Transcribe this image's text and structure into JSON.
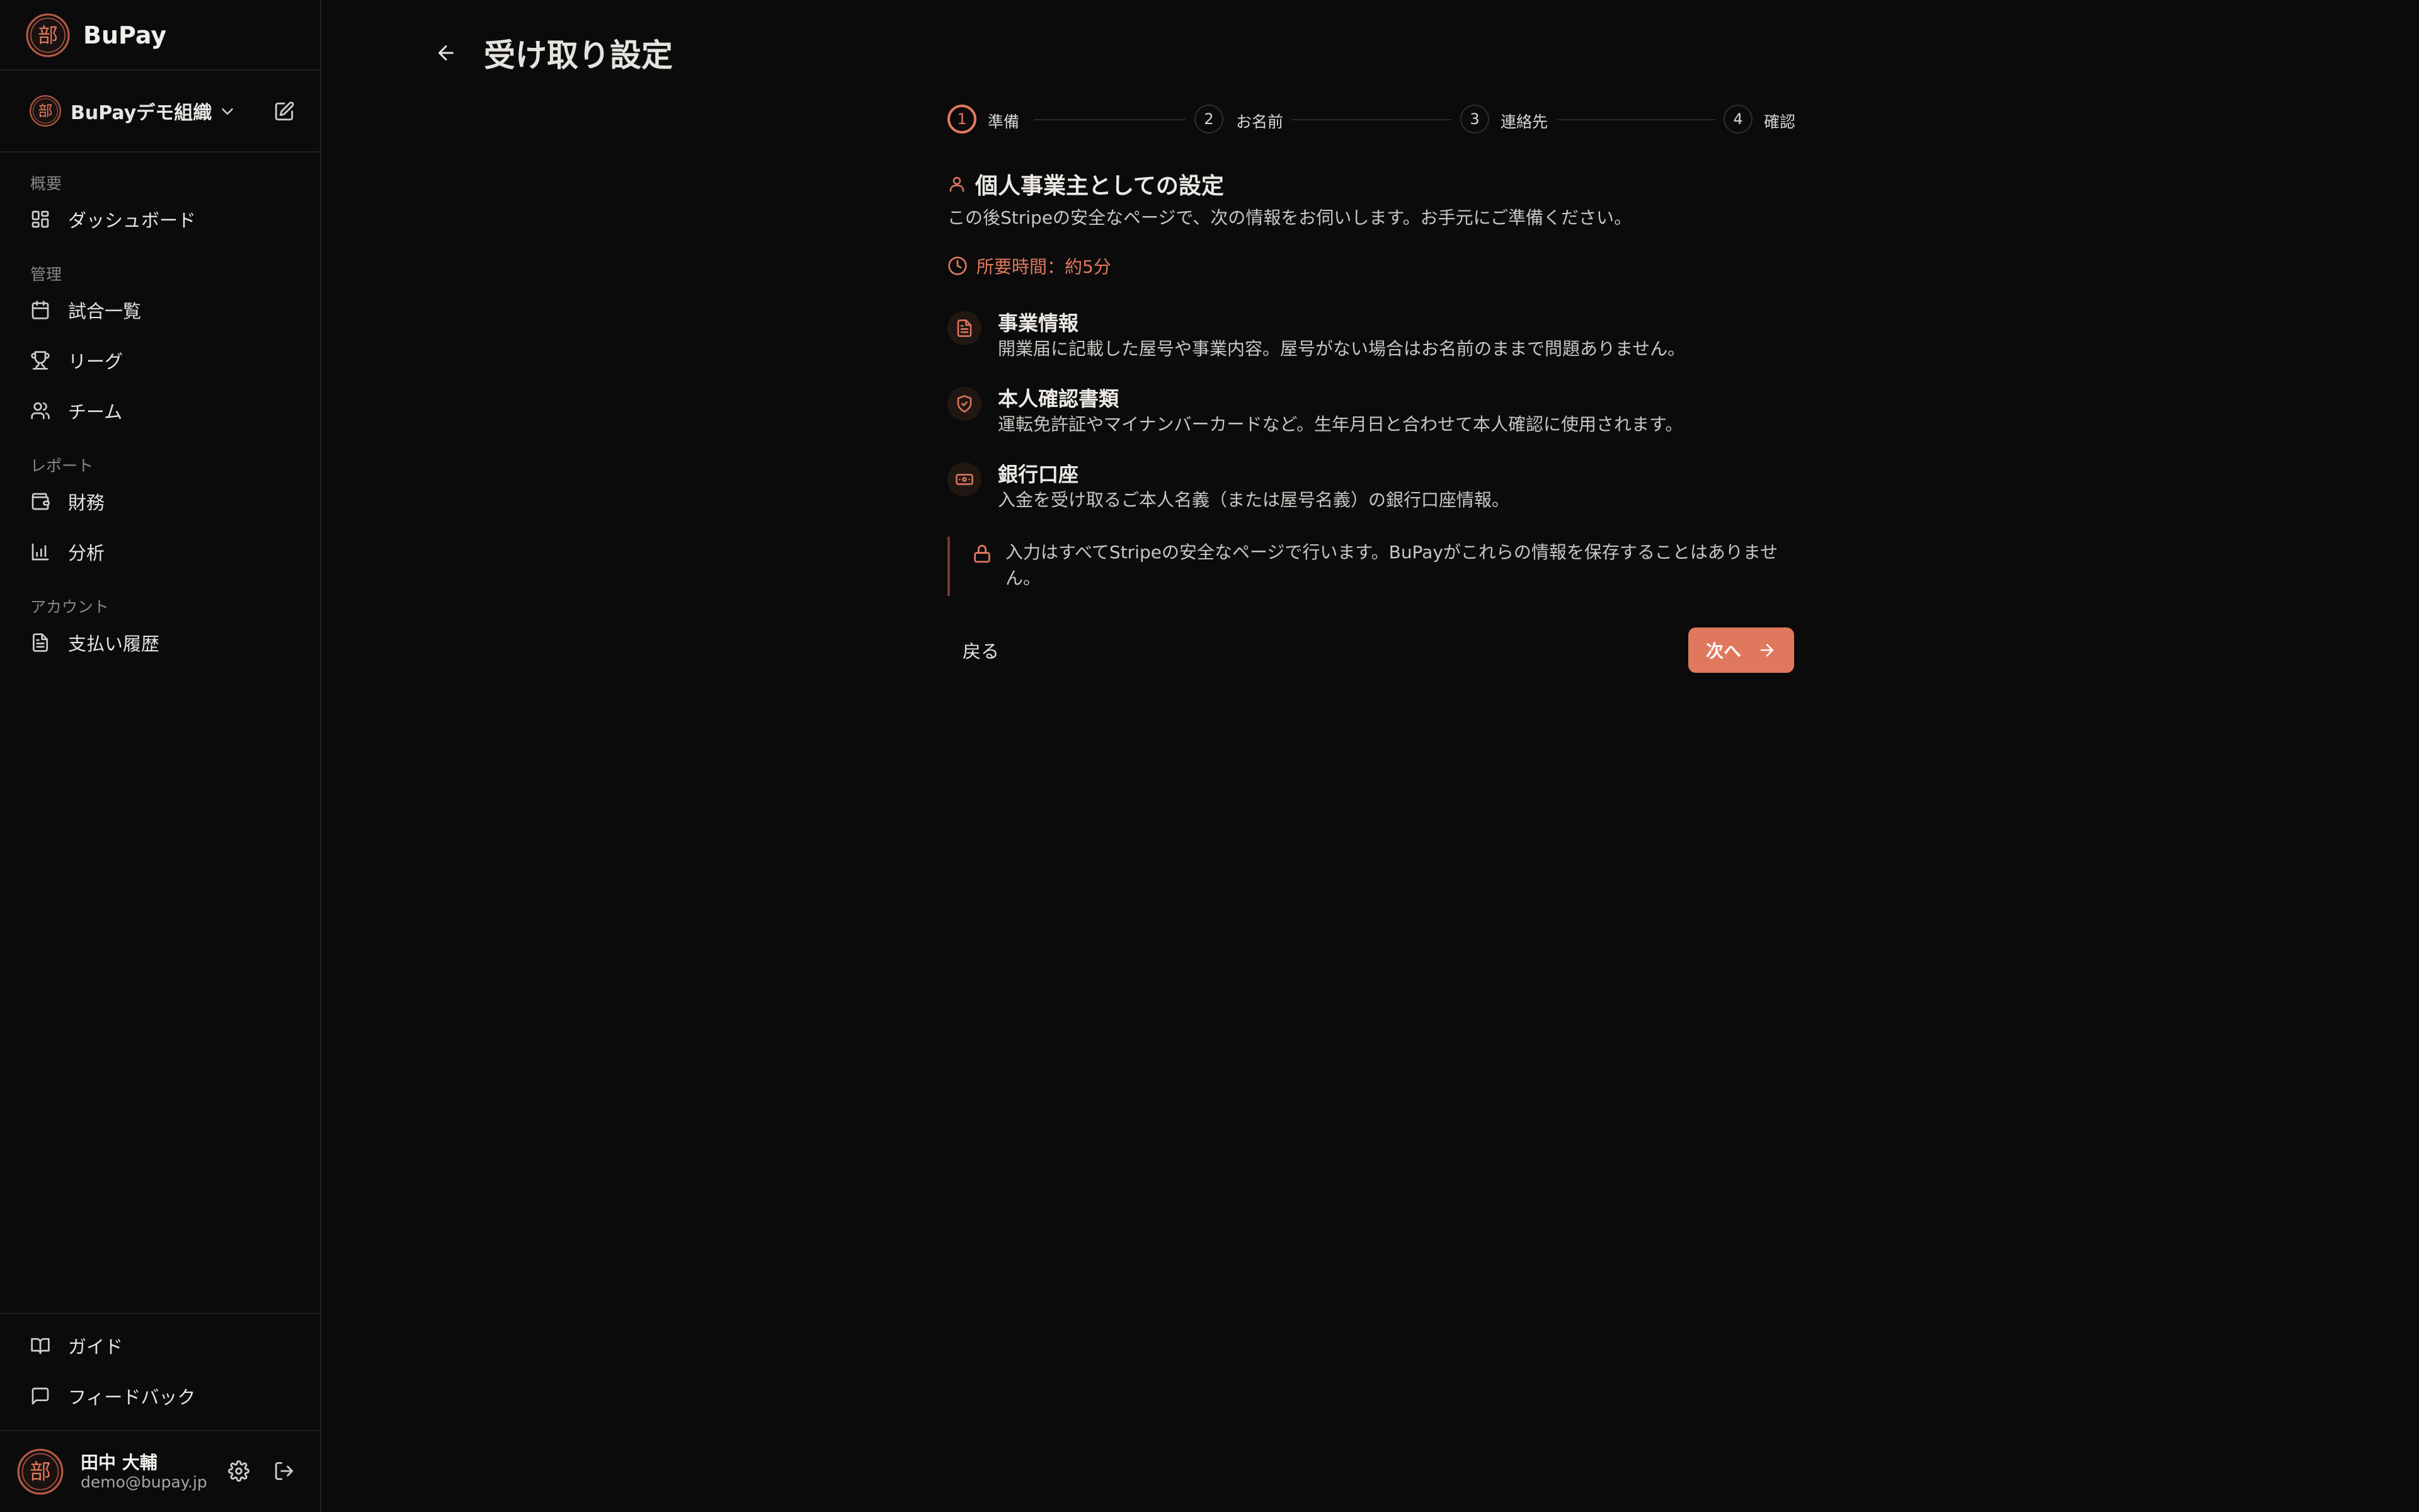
{
  "app": {
    "brand": "BuPay",
    "logo_char": "部"
  },
  "org": {
    "name": "BuPayデモ組織"
  },
  "sidebar": {
    "sections": [
      {
        "label": "概要",
        "items": [
          {
            "label": "ダッシュボード",
            "icon": "dashboard-icon"
          }
        ]
      },
      {
        "label": "管理",
        "items": [
          {
            "label": "試合一覧",
            "icon": "calendar-icon"
          },
          {
            "label": "リーグ",
            "icon": "trophy-icon"
          },
          {
            "label": "チーム",
            "icon": "users-icon"
          }
        ]
      },
      {
        "label": "レポート",
        "items": [
          {
            "label": "財務",
            "icon": "wallet-icon"
          },
          {
            "label": "分析",
            "icon": "bar-chart-icon"
          }
        ]
      },
      {
        "label": "アカウント",
        "items": [
          {
            "label": "支払い履歴",
            "icon": "document-icon"
          }
        ]
      }
    ],
    "bottom_items": [
      {
        "label": "ガイド",
        "icon": "book-icon"
      },
      {
        "label": "フィードバック",
        "icon": "message-icon"
      }
    ]
  },
  "user": {
    "name": "田中 大輔",
    "email": "demo@bupay.jp"
  },
  "page": {
    "title": "受け取り設定"
  },
  "stepper": {
    "current": 1,
    "steps": [
      {
        "num": "1",
        "label": "準備"
      },
      {
        "num": "2",
        "label": "お名前"
      },
      {
        "num": "3",
        "label": "連絡先"
      },
      {
        "num": "4",
        "label": "確認"
      }
    ]
  },
  "content": {
    "heading": "個人事業主としての設定",
    "description": "この後Stripeの安全なページで、次の情報をお伺いします。お手元にご準備ください。",
    "time_estimate": "所要時間：約5分",
    "requirements": [
      {
        "title": "事業情報",
        "description": "開業届に記載した屋号や事業内容。屋号がない場合はお名前のままで問題ありません。",
        "icon": "document-icon"
      },
      {
        "title": "本人確認書類",
        "description": "運転免許証やマイナンバーカードなど。生年月日と合わせて本人確認に使用されます。",
        "icon": "shield-check-icon"
      },
      {
        "title": "銀行口座",
        "description": "入金を受け取るご本人名義（または屋号名義）の銀行口座情報。",
        "icon": "banknote-icon"
      }
    ],
    "notice": "入力はすべてStripeの安全なページで行います。BuPayがこれらの情報を保存することはありません。"
  },
  "actions": {
    "back_label": "戻る",
    "next_label": "次へ"
  },
  "colors": {
    "accent": "#e0785e",
    "background": "#0b0b0b",
    "text": "#e8e6e3",
    "muted": "#8a8784"
  }
}
